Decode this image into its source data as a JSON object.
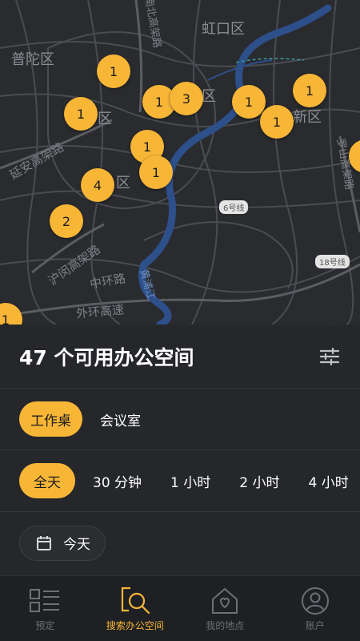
{
  "map": {
    "district_labels": [
      "普陀区",
      "虹口区",
      "区",
      "区",
      "新区",
      "区"
    ],
    "road_labels": [
      "延安高架路",
      "沪闵高架路",
      "中环路",
      "外环高速",
      "南北高架路",
      "黄浦江",
      "罗山高架路"
    ],
    "shields": [
      "6号线",
      "18号线"
    ],
    "pins": [
      "1",
      "1",
      "1",
      "3",
      "1",
      "1",
      "1",
      "1",
      "1",
      "4",
      "2",
      "1"
    ]
  },
  "sheet": {
    "title": "47 个可用办公空间",
    "types": [
      "工作桌",
      "会议室"
    ],
    "durations": [
      "全天",
      "30 分钟",
      "1 小时",
      "2 小时",
      "4 小时"
    ],
    "date": "今天"
  },
  "nav": {
    "items": [
      "预定",
      "搜索办公空间",
      "我的地点",
      "账户"
    ]
  },
  "colors": {
    "accent": "#f8b637",
    "background": "#25272b",
    "map": "#2a2b2f",
    "river": "#2d4f8a"
  }
}
